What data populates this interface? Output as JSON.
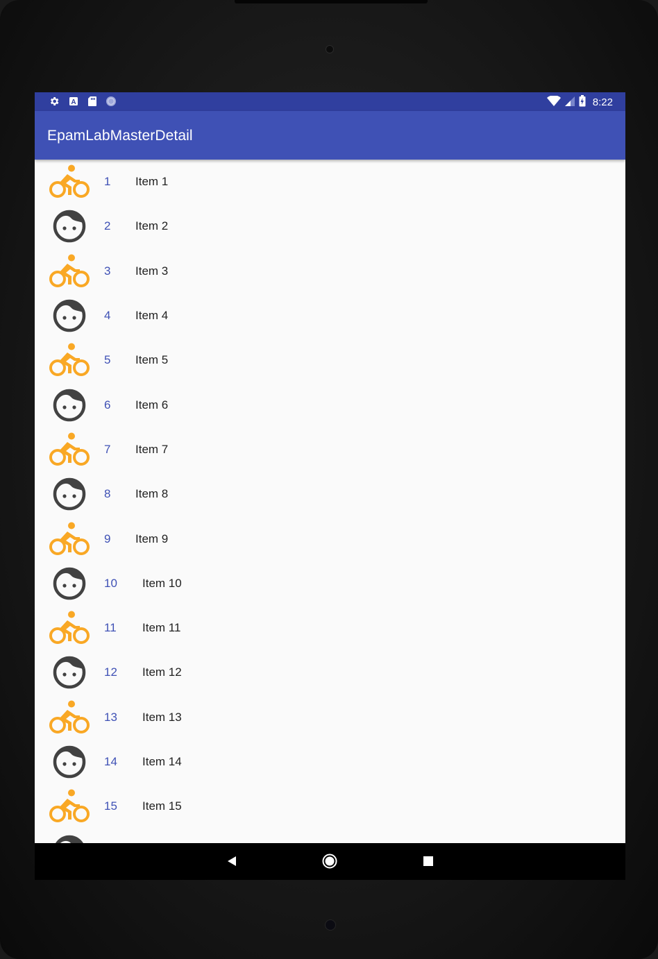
{
  "status_bar": {
    "time": "8:22",
    "left_icons": [
      "settings-icon",
      "a-notification-icon",
      "sd-card-icon",
      "sync-circle-icon"
    ],
    "right_icons": [
      "wifi-icon",
      "signal-icon",
      "battery-icon"
    ]
  },
  "app_bar": {
    "title": "EpamLabMasterDetail"
  },
  "colors": {
    "status_bar": "#303f9f",
    "app_bar": "#3f51b5",
    "bike_icon": "#f9a825",
    "face_icon": "#424242",
    "item_number": "#3f51b5"
  },
  "items": [
    {
      "id": "1",
      "content": "Item 1",
      "icon": "bike-icon"
    },
    {
      "id": "2",
      "content": "Item 2",
      "icon": "face-icon"
    },
    {
      "id": "3",
      "content": "Item 3",
      "icon": "bike-icon"
    },
    {
      "id": "4",
      "content": "Item 4",
      "icon": "face-icon"
    },
    {
      "id": "5",
      "content": "Item 5",
      "icon": "bike-icon"
    },
    {
      "id": "6",
      "content": "Item 6",
      "icon": "face-icon"
    },
    {
      "id": "7",
      "content": "Item 7",
      "icon": "bike-icon"
    },
    {
      "id": "8",
      "content": "Item 8",
      "icon": "face-icon"
    },
    {
      "id": "9",
      "content": "Item 9",
      "icon": "bike-icon"
    },
    {
      "id": "10",
      "content": "Item 10",
      "icon": "face-icon"
    },
    {
      "id": "11",
      "content": "Item 11",
      "icon": "bike-icon"
    },
    {
      "id": "12",
      "content": "Item 12",
      "icon": "face-icon"
    },
    {
      "id": "13",
      "content": "Item 13",
      "icon": "bike-icon"
    },
    {
      "id": "14",
      "content": "Item 14",
      "icon": "face-icon"
    },
    {
      "id": "15",
      "content": "Item 15",
      "icon": "bike-icon"
    },
    {
      "id": "",
      "content": "",
      "icon": "face-icon"
    }
  ],
  "nav_bar": {
    "buttons": [
      "back-icon",
      "home-icon",
      "recents-icon"
    ]
  }
}
